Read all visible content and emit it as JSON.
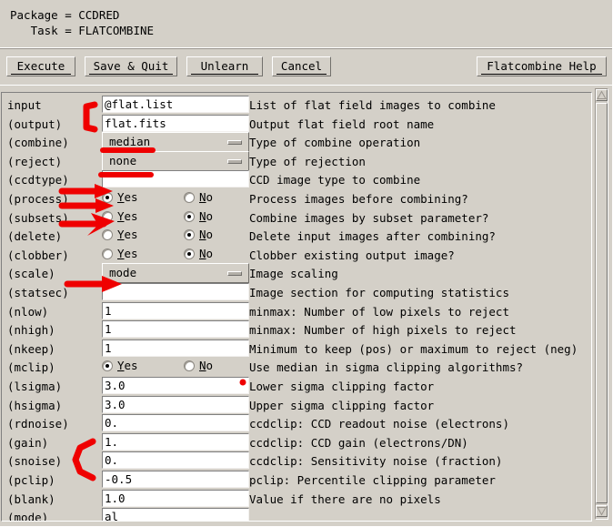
{
  "header": {
    "package_line": "Package = CCDRED",
    "task_line": "   Task = FLATCOMBINE"
  },
  "toolbar": {
    "execute_label": "Execute",
    "save_quit_label": "Save & Quit",
    "unlearn_label": "Unlearn",
    "cancel_label": "Cancel",
    "help_label": "Flatcombine Help"
  },
  "radio": {
    "yes_prefix": "Y",
    "yes_rest": "es",
    "no_prefix": "N",
    "no_rest": "o"
  },
  "colors": {
    "face": "#d4d0c8",
    "annotation": "#ef0000",
    "field_bg": "#ffffff",
    "text": "#000000"
  },
  "form": {
    "rows": [
      {
        "name": "input",
        "label": "input",
        "type": "text",
        "value": "@flat.list",
        "desc": "List of flat field images to combine"
      },
      {
        "name": "output",
        "label": "(output)",
        "type": "text",
        "value": "flat.fits",
        "desc": "Output flat field root name"
      },
      {
        "name": "combine",
        "label": "(combine)",
        "type": "menu",
        "value": "median",
        "desc": "Type of combine operation"
      },
      {
        "name": "reject",
        "label": "(reject)",
        "type": "menu",
        "value": "none",
        "desc": "Type of rejection"
      },
      {
        "name": "ccdtype",
        "label": "(ccdtype)",
        "type": "text",
        "value": "",
        "desc": "CCD image type to combine"
      },
      {
        "name": "process",
        "label": "(process)",
        "type": "radio",
        "value": "yes",
        "desc": "Process images before combining?"
      },
      {
        "name": "subsets",
        "label": "(subsets)",
        "type": "radio",
        "value": "no",
        "desc": "Combine images by subset parameter?"
      },
      {
        "name": "delete",
        "label": "(delete)",
        "type": "radio",
        "value": "no",
        "desc": "Delete input images after combining?"
      },
      {
        "name": "clobber",
        "label": "(clobber)",
        "type": "radio",
        "value": "no",
        "desc": "Clobber existing output image?"
      },
      {
        "name": "scale",
        "label": "(scale)",
        "type": "menu",
        "value": "mode",
        "desc": "Image scaling"
      },
      {
        "name": "statsec",
        "label": "(statsec)",
        "type": "text",
        "value": "",
        "desc": "Image section for computing statistics"
      },
      {
        "name": "nlow",
        "label": "(nlow)",
        "type": "text",
        "value": "1",
        "desc": "minmax: Number of low pixels to reject"
      },
      {
        "name": "nhigh",
        "label": "(nhigh)",
        "type": "text",
        "value": "1",
        "desc": "minmax: Number of high pixels to reject"
      },
      {
        "name": "nkeep",
        "label": "(nkeep)",
        "type": "text",
        "value": "1",
        "desc": "Minimum to keep (pos) or maximum to reject (neg)"
      },
      {
        "name": "mclip",
        "label": "(mclip)",
        "type": "radio",
        "value": "yes",
        "desc": "Use median in sigma clipping algorithms?"
      },
      {
        "name": "lsigma",
        "label": "(lsigma)",
        "type": "text",
        "value": "3.0",
        "desc": "Lower sigma clipping factor"
      },
      {
        "name": "hsigma",
        "label": "(hsigma)",
        "type": "text",
        "value": "3.0",
        "desc": "Upper sigma clipping factor"
      },
      {
        "name": "rdnoise",
        "label": "(rdnoise)",
        "type": "text",
        "value": "0.",
        "desc": "ccdclip: CCD readout noise (electrons)"
      },
      {
        "name": "gain",
        "label": "(gain)",
        "type": "text",
        "value": "1.",
        "desc": "ccdclip: CCD gain (electrons/DN)"
      },
      {
        "name": "snoise",
        "label": "(snoise)",
        "type": "text",
        "value": "0.",
        "desc": "ccdclip: Sensitivity noise (fraction)"
      },
      {
        "name": "pclip",
        "label": "(pclip)",
        "type": "text",
        "value": "-0.5",
        "desc": "pclip: Percentile clipping parameter"
      },
      {
        "name": "blank",
        "label": "(blank)",
        "type": "text",
        "value": "1.0",
        "desc": "Value if there are no pixels"
      },
      {
        "name": "mode",
        "label": "(mode)",
        "type": "text",
        "value": "al",
        "desc": ""
      }
    ]
  },
  "annotations": [
    {
      "name": "bracket-input-output",
      "shape": "bracket"
    },
    {
      "name": "underline-combine",
      "shape": "underline"
    },
    {
      "name": "underline-reject",
      "shape": "underline"
    },
    {
      "name": "arrow-ccdtype",
      "shape": "arrow"
    },
    {
      "name": "arrow-process",
      "shape": "arrow"
    },
    {
      "name": "arrow-subsets",
      "shape": "arrow"
    },
    {
      "name": "arrow-scale",
      "shape": "arrow"
    },
    {
      "name": "curve-gain-snoise",
      "shape": "curve"
    },
    {
      "name": "dot-lsigma",
      "shape": "dot"
    }
  ]
}
